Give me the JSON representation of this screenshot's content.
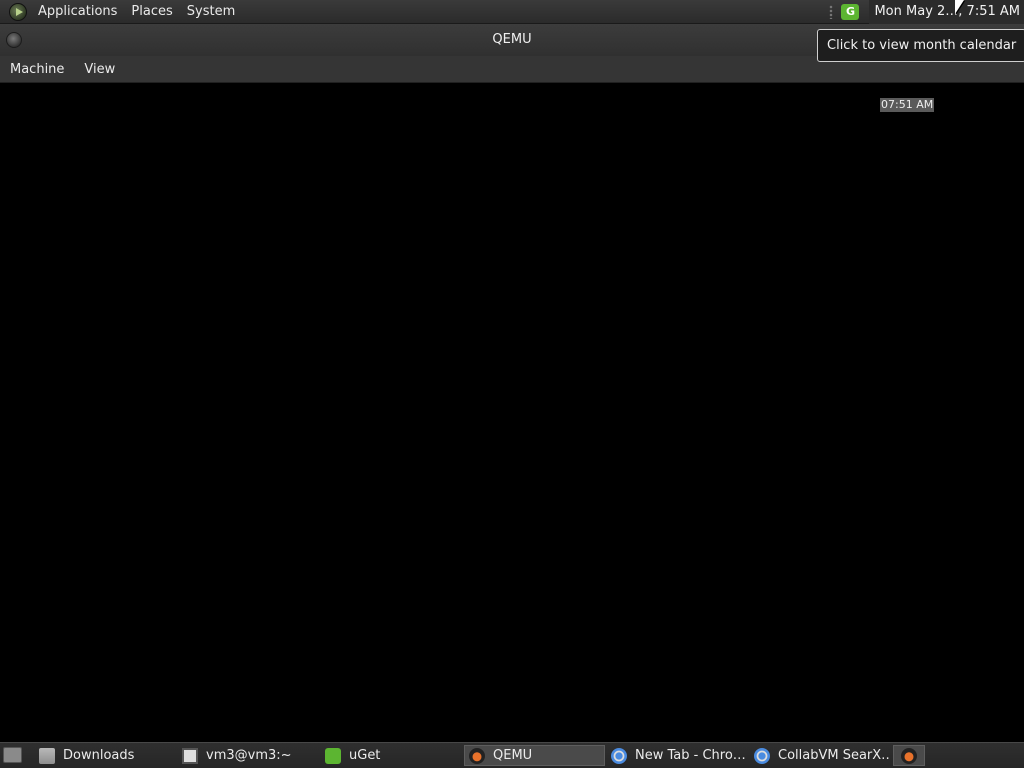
{
  "top_panel": {
    "menus": [
      "Applications",
      "Places",
      "System"
    ],
    "tray_icon": "uget-tray-icon",
    "clock": "Mon May 2…, 7:51 AM"
  },
  "tooltip": {
    "text": "Click to view month calendar"
  },
  "qemu_window": {
    "title": "QEMU",
    "menus": [
      "Machine",
      "View"
    ],
    "guest_clock": "07:51 AM"
  },
  "taskbar": {
    "tasks": [
      {
        "label": "Downloads",
        "icon": "folder-icon"
      },
      {
        "label": "vm3@vm3:~",
        "icon": "terminal-icon"
      },
      {
        "label": "uGet",
        "icon": "uget-icon"
      },
      {
        "label": "QEMU",
        "icon": "qemu-icon",
        "active": true
      },
      {
        "label": "New Tab - Chro…",
        "icon": "chrome-icon"
      },
      {
        "label": "CollabVM SearX…",
        "icon": "chrome-icon"
      }
    ]
  }
}
